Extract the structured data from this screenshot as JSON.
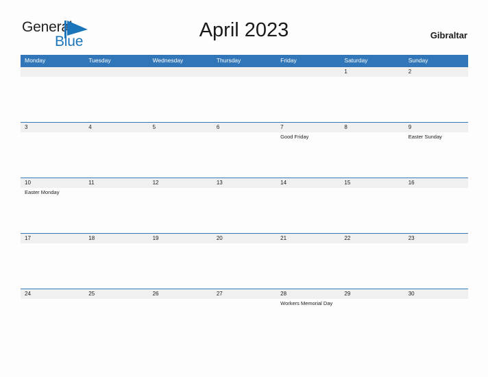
{
  "brand": {
    "name_part1": "General",
    "name_part2": "Blue",
    "mark": "blue-triangle-flag",
    "color_dark": "#231f20",
    "color_blue": "#1b75bb"
  },
  "header": {
    "title": "April 2023",
    "location": "Gibraltar"
  },
  "theme": {
    "header_blue": "#3176b8",
    "date_strip_gray": "#f0f0f0",
    "background": "#fdfdfd",
    "text": "#1a1a1a"
  },
  "calendar": {
    "month": "April",
    "year": "2023",
    "weekday_headers": [
      "Monday",
      "Tuesday",
      "Wednesday",
      "Thursday",
      "Friday",
      "Saturday",
      "Sunday"
    ],
    "weeks": [
      {
        "days": [
          {
            "date": "",
            "event": ""
          },
          {
            "date": "",
            "event": ""
          },
          {
            "date": "",
            "event": ""
          },
          {
            "date": "",
            "event": ""
          },
          {
            "date": "",
            "event": ""
          },
          {
            "date": "1",
            "event": ""
          },
          {
            "date": "2",
            "event": ""
          }
        ]
      },
      {
        "days": [
          {
            "date": "3",
            "event": ""
          },
          {
            "date": "4",
            "event": ""
          },
          {
            "date": "5",
            "event": ""
          },
          {
            "date": "6",
            "event": ""
          },
          {
            "date": "7",
            "event": "Good Friday"
          },
          {
            "date": "8",
            "event": ""
          },
          {
            "date": "9",
            "event": "Easter Sunday"
          }
        ]
      },
      {
        "days": [
          {
            "date": "10",
            "event": "Easter Monday"
          },
          {
            "date": "11",
            "event": ""
          },
          {
            "date": "12",
            "event": ""
          },
          {
            "date": "13",
            "event": ""
          },
          {
            "date": "14",
            "event": ""
          },
          {
            "date": "15",
            "event": ""
          },
          {
            "date": "16",
            "event": ""
          }
        ]
      },
      {
        "days": [
          {
            "date": "17",
            "event": ""
          },
          {
            "date": "18",
            "event": ""
          },
          {
            "date": "19",
            "event": ""
          },
          {
            "date": "20",
            "event": ""
          },
          {
            "date": "21",
            "event": ""
          },
          {
            "date": "22",
            "event": ""
          },
          {
            "date": "23",
            "event": ""
          }
        ]
      },
      {
        "days": [
          {
            "date": "24",
            "event": ""
          },
          {
            "date": "25",
            "event": ""
          },
          {
            "date": "26",
            "event": ""
          },
          {
            "date": "27",
            "event": ""
          },
          {
            "date": "28",
            "event": "Workers Memorial Day"
          },
          {
            "date": "29",
            "event": ""
          },
          {
            "date": "30",
            "event": ""
          }
        ]
      }
    ]
  }
}
